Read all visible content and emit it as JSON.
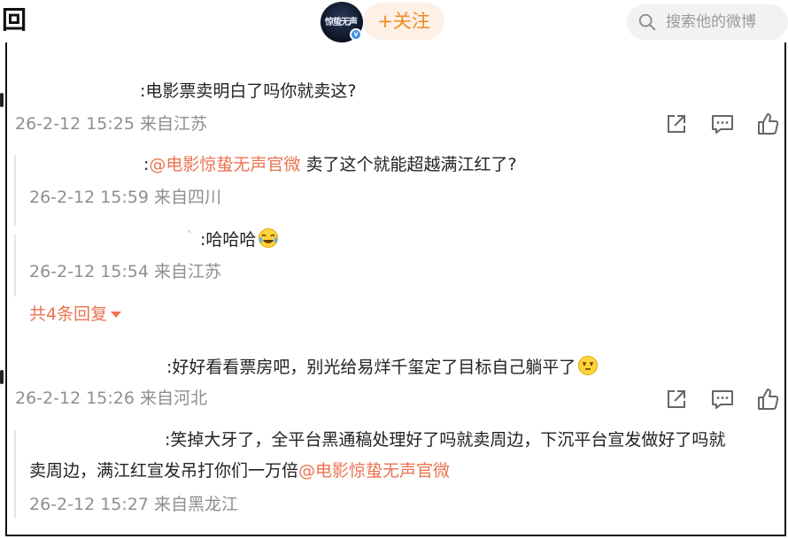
{
  "header": {
    "back_glyph": "回",
    "avatar_text": "惊蛰无声",
    "verified_mark": "v",
    "follow_label": "+关注",
    "search_placeholder": "搜索他的微博"
  },
  "colors": {
    "accent_orange": "#f08a24",
    "mention": "#eb7350",
    "meta_gray": "#8f8f8f",
    "verified_blue": "#3f8fe6"
  },
  "comments": [
    {
      "text": ":电影票卖明白了吗你就卖这?",
      "meta": "26-2-12 15:25 来自江苏",
      "replies": [
        {
          "prefix": ":",
          "mention": "@电影惊蛰无声官微",
          "text": " 卖了这个就能超越满江红了?",
          "meta": "26-2-12 15:59 来自四川"
        },
        {
          "stray": "`",
          "text": ":哈哈哈",
          "emoji": "laugh-cry-emoji",
          "meta": "26-2-12 15:54 来自江苏"
        }
      ],
      "more_replies": "共4条回复"
    },
    {
      "text": ":好好看看票房吧，别光给易烊千玺定了目标自己躺平了",
      "emoji": "awkward-emoji",
      "meta": "26-2-12 15:26 来自河北",
      "replies": [
        {
          "line1": ":笑掉大牙了，全平台黑通稿处理好了吗就卖周边，下沉平台宣发做好了吗就",
          "line2": "卖周边，满江红宣发吊打你们一万倍",
          "mention": "@电影惊蛰无声官微",
          "meta": "26-2-12 15:27 来自黑龙江"
        }
      ]
    }
  ],
  "actions": [
    "share-icon",
    "comment-icon",
    "like-icon"
  ]
}
